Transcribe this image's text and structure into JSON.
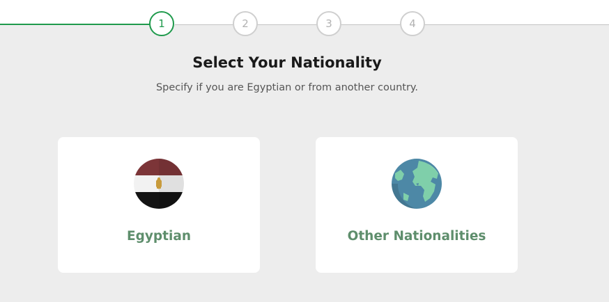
{
  "stepper": {
    "steps": [
      "1",
      "2",
      "3",
      "4"
    ],
    "active_step": 1
  },
  "header": {
    "title": "Select Your Nationality",
    "subtitle": "Specify if you are Egyptian or from another country."
  },
  "options": [
    {
      "label": "Egyptian",
      "icon": "egypt-flag-icon"
    },
    {
      "label": "Other Nationalities",
      "icon": "globe-icon"
    }
  ],
  "colors": {
    "accent": "#1f9a4c",
    "option_label": "#5e8e6c",
    "background": "#ededed",
    "card": "#ffffff"
  }
}
